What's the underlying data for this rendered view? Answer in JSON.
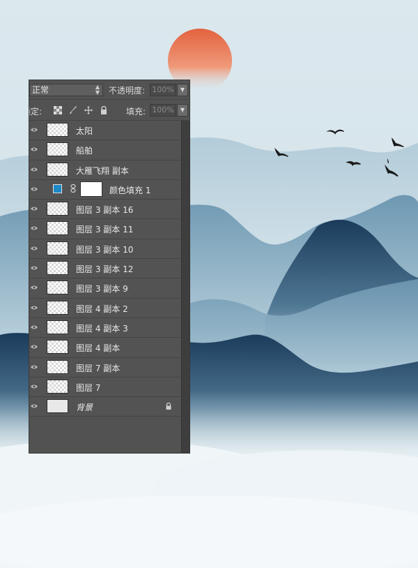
{
  "panel": {
    "blend_mode": "正常",
    "opacity_label": "不透明度:",
    "opacity_value": "100%",
    "lock_label": "锁定:",
    "fill_label": "填充:",
    "fill_value": "100%"
  },
  "layers": [
    {
      "name": "太阳"
    },
    {
      "name": "船舶"
    },
    {
      "name": "大雁飞翔 副本"
    },
    {
      "name": "颜色填充 1",
      "fill_color": "#1e88c7"
    },
    {
      "name": "图层 3 副本 16"
    },
    {
      "name": "图层 3 副本 11"
    },
    {
      "name": "图层 3 副本 10"
    },
    {
      "name": "图层 3 副本 12"
    },
    {
      "name": "图层 3 副本 9"
    },
    {
      "name": "图层 4 副本 2"
    },
    {
      "name": "图层 4 副本 3"
    },
    {
      "name": "图层 4 副本"
    },
    {
      "name": "图层 7 副本"
    },
    {
      "name": "图层 7"
    },
    {
      "name": "背景",
      "locked": true
    }
  ],
  "colors": {
    "sun": "#e4623f",
    "sky": "#dce9ee",
    "mountain_dark": "#1d3d5e",
    "panel_bg": "#525252"
  }
}
